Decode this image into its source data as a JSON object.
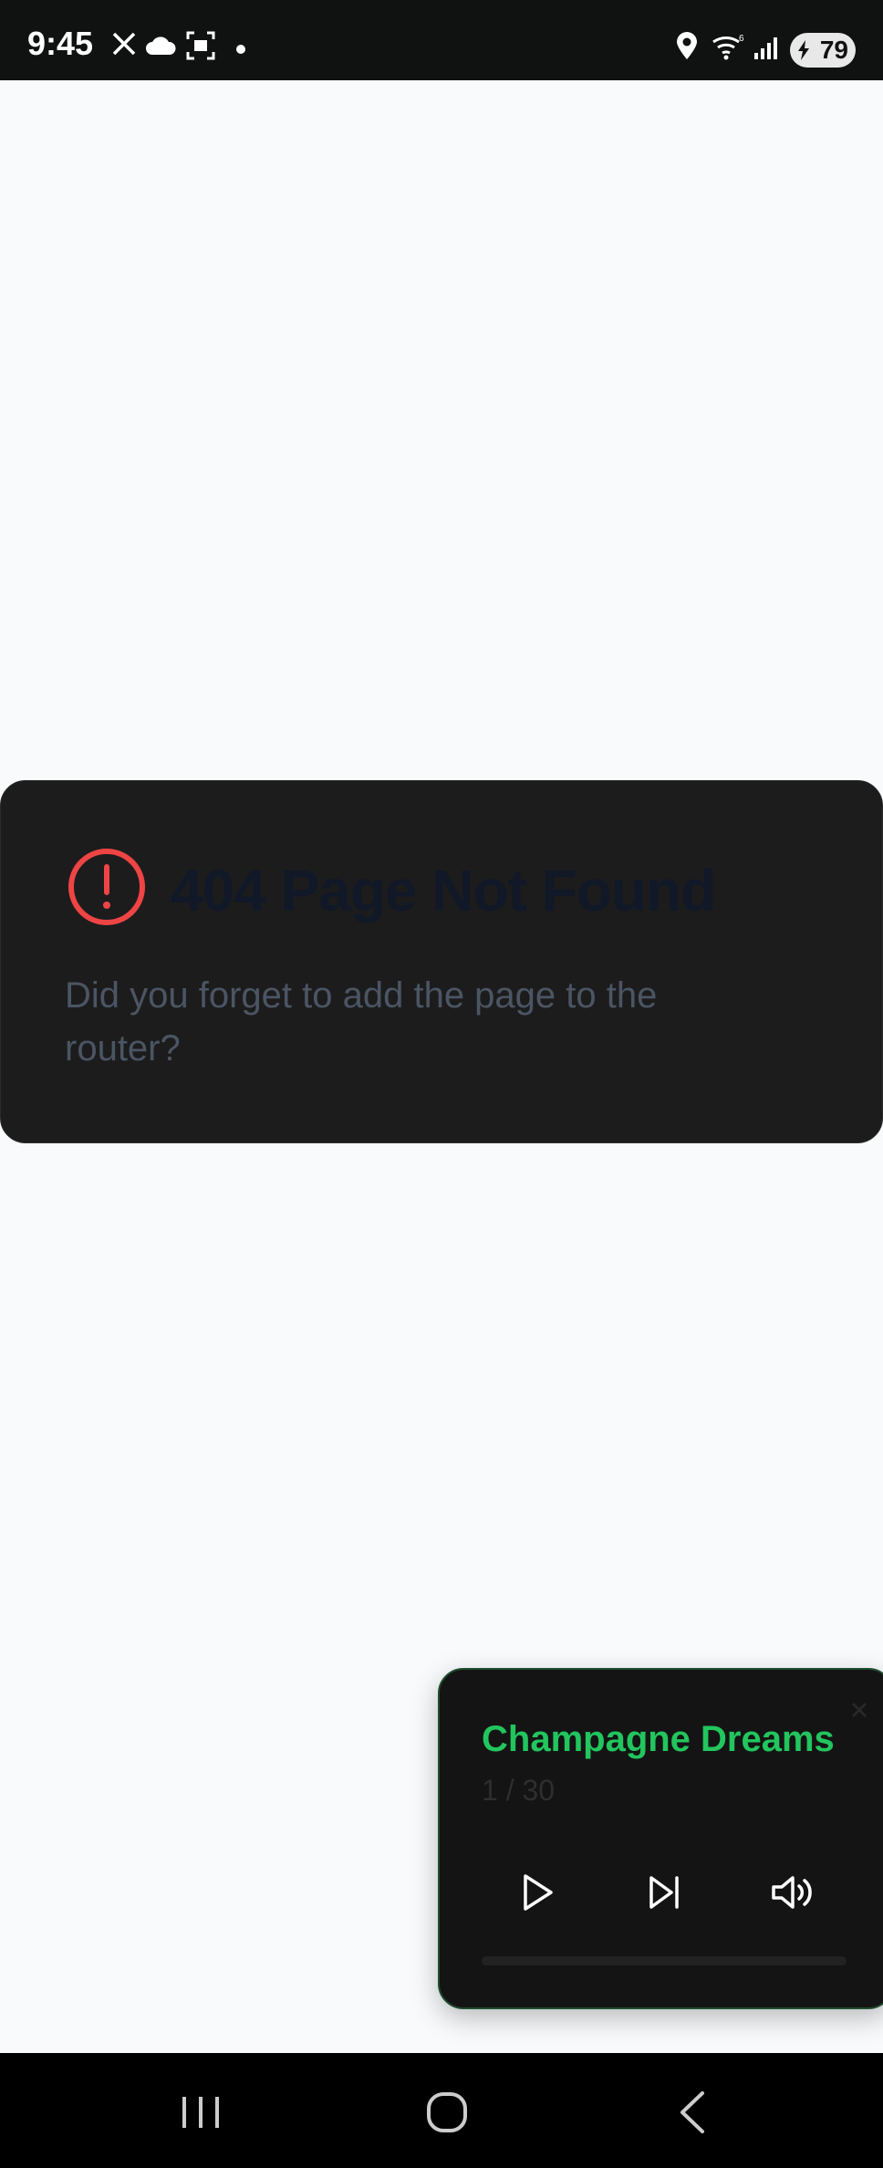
{
  "status_bar": {
    "time": "9:45",
    "battery": "79",
    "icons": [
      "x-icon",
      "cloud-icon",
      "screenshot-icon",
      "dot-icon",
      "location-icon",
      "wifi-icon",
      "signal-icon",
      "battery-icon"
    ]
  },
  "error_card": {
    "title": "404 Page Not Found",
    "description": "Did you forget to add the page to the router?",
    "icon": "alert-circle-icon",
    "icon_color": "#ef4444"
  },
  "player": {
    "track_title": "Champagne Dreams",
    "track_position": "1 / 30",
    "progress": 0,
    "accent": "#22c55e",
    "controls": [
      "play-icon",
      "skip-next-icon",
      "volume-icon",
      "close-icon"
    ]
  },
  "nav_bar": {
    "buttons": [
      "recent-apps-icon",
      "home-icon",
      "back-icon"
    ]
  }
}
